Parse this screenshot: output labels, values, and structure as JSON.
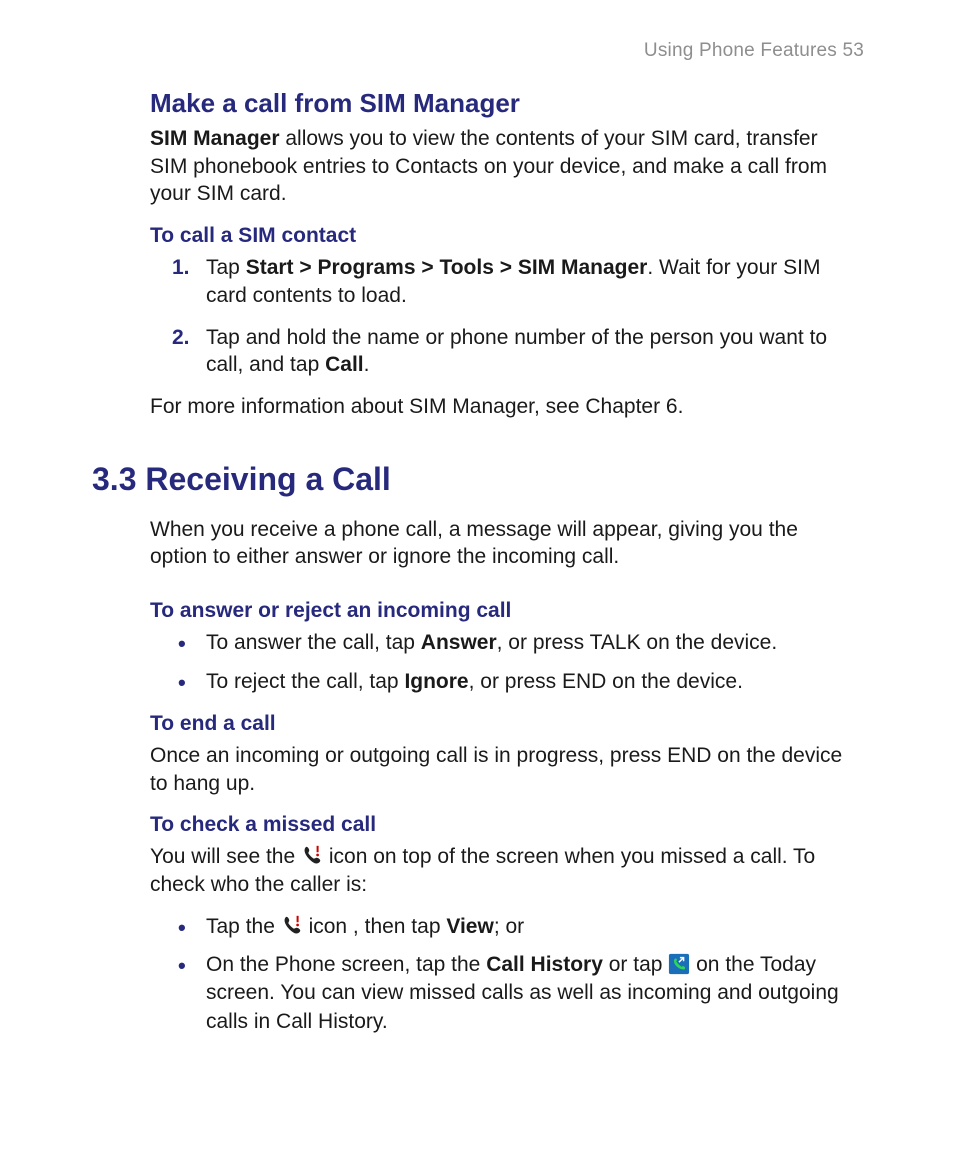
{
  "header": {
    "running_head": "Using Phone Features  53"
  },
  "sec1": {
    "title": "Make a call from SIM Manager",
    "intro_pre": "SIM Manager",
    "intro_post": " allows you to view the contents of your SIM card, transfer SIM phonebook entries to Contacts on your device, and make a call from your SIM card.",
    "sub1": "To call a SIM contact",
    "step1_n": "1.",
    "step1_pre": "Tap ",
    "step1_bold": "Start > Programs > Tools > SIM Manager",
    "step1_post": ". Wait for your SIM card contents to load.",
    "step2_n": "2.",
    "step2_pre": "Tap and hold the name or phone number of the person you want to call, and tap ",
    "step2_bold": "Call",
    "step2_post": ".",
    "footer": "For more information about SIM Manager, see Chapter 6."
  },
  "sec2": {
    "title": "3.3 Receiving a Call",
    "intro": "When you receive a phone call, a message will appear, giving you the option to either answer or ignore the incoming call.",
    "sub1": "To answer or reject an incoming call",
    "b1_pre": "To answer the call, tap ",
    "b1_bold": "Answer",
    "b1_post": ", or press TALK on the device.",
    "b2_pre": "To reject the call, tap ",
    "b2_bold": "Ignore",
    "b2_post": ", or press END on the device.",
    "sub2": "To end a call",
    "end_para": "Once an incoming or outgoing call is in progress, press END on the device to hang up.",
    "sub3": "To check a missed call",
    "miss_pre": "You will see the ",
    "miss_post": " icon on top of the screen when you missed a call. To check who the caller is:",
    "m1_pre": "Tap the ",
    "m1_mid": " icon , then tap ",
    "m1_bold": "View",
    "m1_post": "; or",
    "m2_pre": "On the Phone screen, tap the ",
    "m2_bold": "Call History",
    "m2_mid": " or tap ",
    "m2_post": " on the Today screen. You can view missed calls as well as incoming and outgoing calls in Call History."
  }
}
